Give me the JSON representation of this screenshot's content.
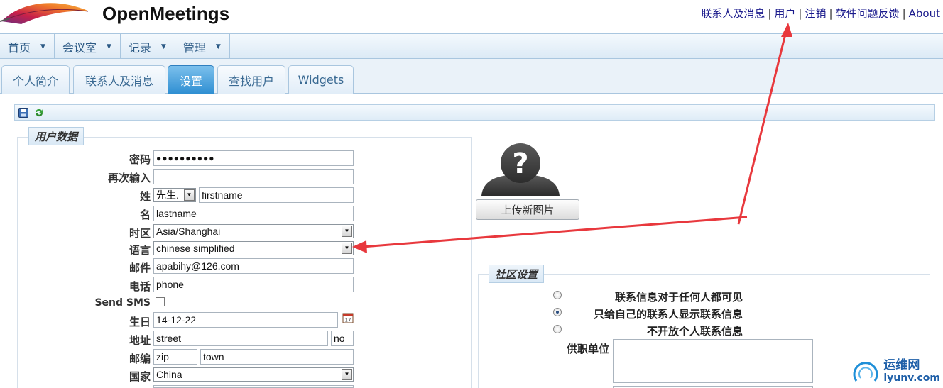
{
  "app": {
    "title": "OpenMeetings"
  },
  "top_links": [
    "联系人及消息",
    "用户",
    "注销",
    "软件问题反馈",
    "About"
  ],
  "menu": [
    "首页",
    "会议室",
    "记录",
    "管理"
  ],
  "tabs": [
    {
      "label": "个人简介",
      "active": false
    },
    {
      "label": "联系人及消息",
      "active": false
    },
    {
      "label": "设置",
      "active": true
    },
    {
      "label": "查找用户",
      "active": false
    },
    {
      "label": "Widgets",
      "active": false
    }
  ],
  "toolbar": {
    "icons": [
      "save-icon",
      "refresh-icon"
    ]
  },
  "user_data": {
    "legend": "用户数据",
    "labels": {
      "password": "密码",
      "confirm": "再次输入",
      "lastname": "姓",
      "firstname": "名",
      "timezone": "时区",
      "language": "语言",
      "email": "邮件",
      "phone": "电话",
      "sms": "Send SMS",
      "birthday": "生日",
      "address": "地址",
      "zip": "邮编",
      "country": "国家"
    },
    "values": {
      "password": "●●●●●●●●●●",
      "confirm": "",
      "salutation": "先生.",
      "firstname_field": "firstname",
      "lastname_field": "lastname",
      "timezone": "Asia/Shanghai",
      "language": "chinese simplified",
      "email": "apabihy@126.com",
      "phone": "phone",
      "sms_checked": false,
      "birthday": "14-12-22",
      "street": "street",
      "house_no": "no",
      "zip": "zip",
      "town": "town",
      "country": "China"
    }
  },
  "avatar": {
    "upload_label": "上传新图片"
  },
  "community": {
    "legend": "社区设置",
    "options": [
      {
        "label": "联系信息对于任何人都可见",
        "checked": false
      },
      {
        "label": "只给自己的联系人显示联系信息",
        "checked": true
      },
      {
        "label": "不开放个人联系信息",
        "checked": false
      }
    ],
    "employer_label": "供职单位",
    "employer_value": ""
  },
  "watermark": {
    "cn": "运维网",
    "en": "iyunv.com"
  },
  "colors": {
    "accent": "#2f8fd2",
    "annotation": "#e8383d",
    "link": "#1a1a8c"
  }
}
